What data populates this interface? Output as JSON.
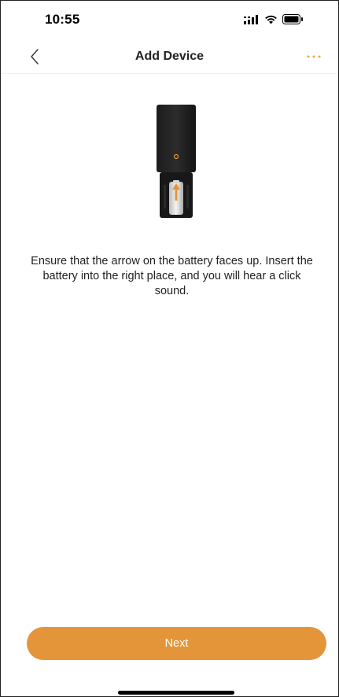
{
  "status_bar": {
    "time": "10:55"
  },
  "nav": {
    "title": "Add Device",
    "back_icon": "chevron-left-icon",
    "more_icon": "more-dots-icon"
  },
  "content": {
    "instruction": "Ensure that the arrow on the battery faces up. Insert the battery into the right place, and you will hear a click sound."
  },
  "footer": {
    "next_label": "Next"
  },
  "colors": {
    "accent": "#e4953a",
    "more_icon": "#f0a63a"
  }
}
